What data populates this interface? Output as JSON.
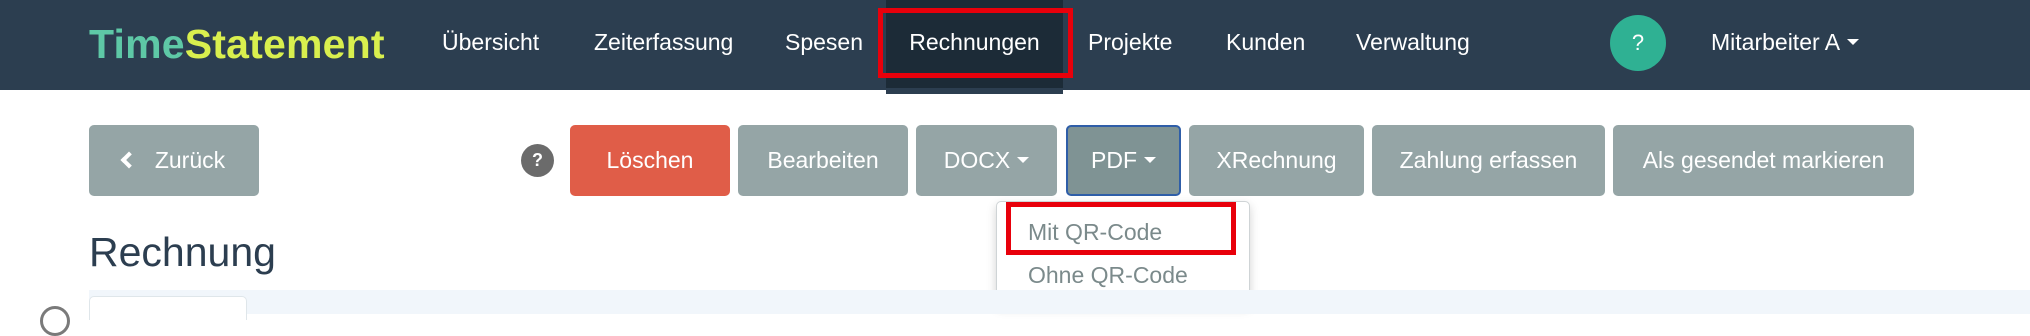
{
  "brand": {
    "part1": "Time",
    "part2": "Statement"
  },
  "nav": {
    "items": [
      {
        "label": "Übersicht"
      },
      {
        "label": "Zeiterfassung"
      },
      {
        "label": "Spesen"
      },
      {
        "label": "Rechnungen",
        "active": true
      },
      {
        "label": "Projekte"
      },
      {
        "label": "Kunden"
      },
      {
        "label": "Verwaltung"
      }
    ],
    "help_label": "?",
    "user_label": "Mitarbeiter A"
  },
  "toolbar": {
    "back_label": "Zurück",
    "help_label": "?",
    "delete_label": "Löschen",
    "edit_label": "Bearbeiten",
    "docx_label": "DOCX",
    "pdf_label": "PDF",
    "xrechnung_label": "XRechnung",
    "payment_label": "Zahlung erfassen",
    "mark_sent_label": "Als gesendet markieren"
  },
  "pdf_dropdown": {
    "options": [
      {
        "label": "Mit QR-Code",
        "highlighted": true
      },
      {
        "label": "Ohne QR-Code"
      }
    ]
  },
  "page": {
    "title": "Rechnung"
  },
  "colors": {
    "navbar": "#2c3e50",
    "brand_time": "#5ec8a6",
    "brand_statement": "#d9ef4e",
    "button_default": "#95a5a6",
    "button_danger": "#e05d48",
    "help_nav": "#2fb193",
    "highlight_box": "#e8000b"
  }
}
